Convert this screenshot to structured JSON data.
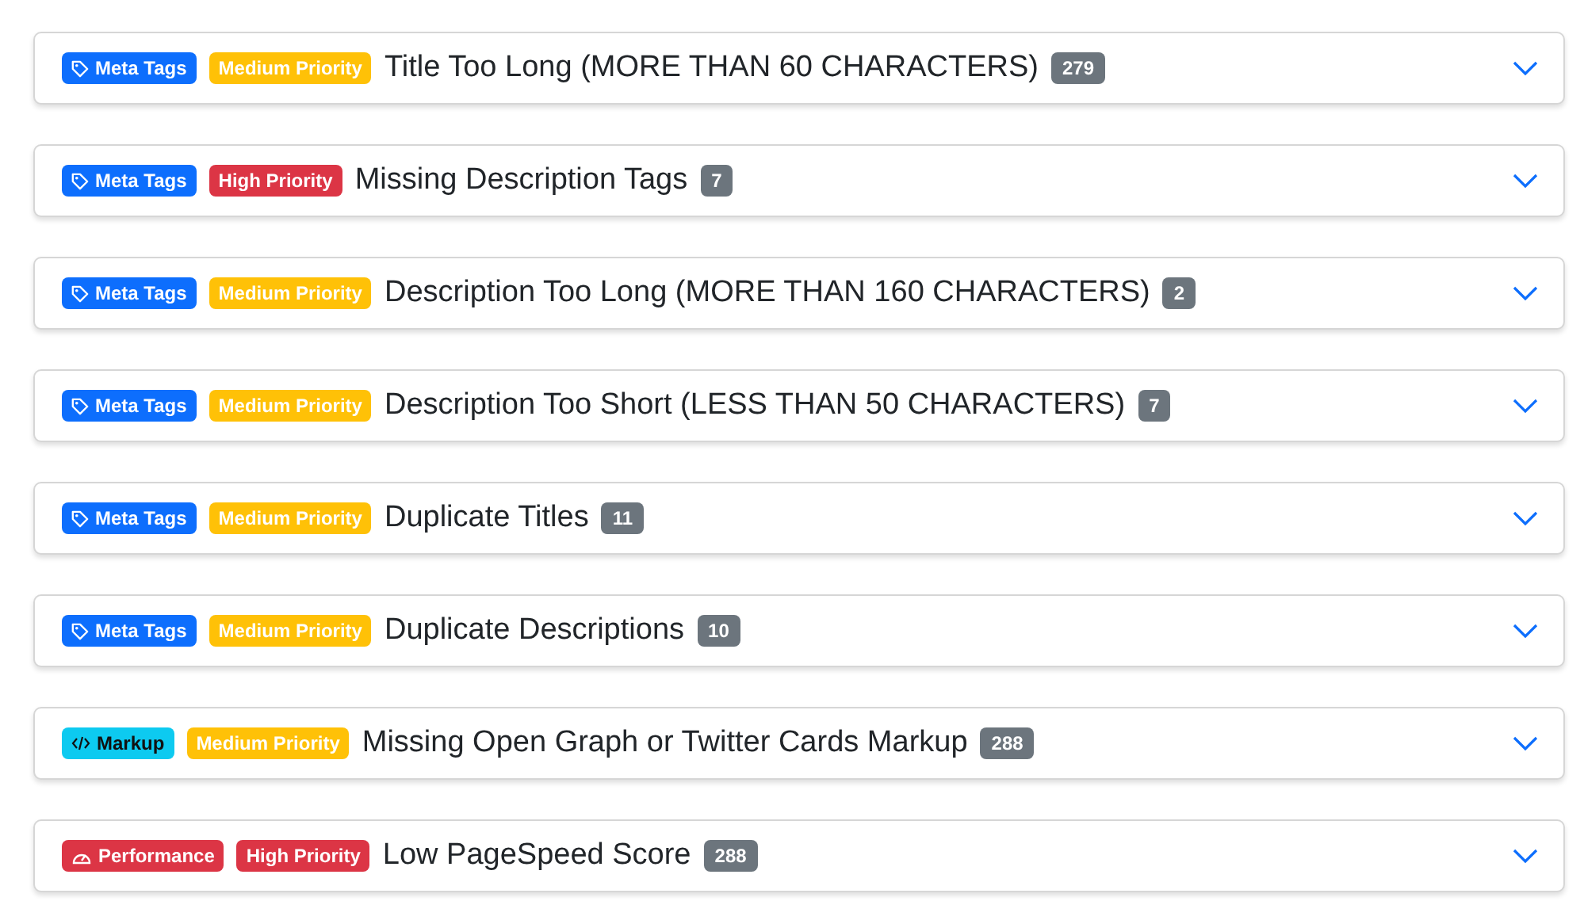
{
  "issues": [
    {
      "category": {
        "kind": "meta",
        "label": "Meta Tags"
      },
      "priority": {
        "kind": "medium",
        "label": "Medium Priority"
      },
      "title": "Title Too Long (MORE THAN 60 CHARACTERS)",
      "count": "279",
      "expanded": false
    },
    {
      "category": {
        "kind": "meta",
        "label": "Meta Tags"
      },
      "priority": {
        "kind": "high",
        "label": "High Priority"
      },
      "title": "Missing Description Tags",
      "count": "7",
      "expanded": false
    },
    {
      "category": {
        "kind": "meta",
        "label": "Meta Tags"
      },
      "priority": {
        "kind": "medium",
        "label": "Medium Priority"
      },
      "title": "Description Too Long (MORE THAN 160 CHARACTERS)",
      "count": "2",
      "expanded": false
    },
    {
      "category": {
        "kind": "meta",
        "label": "Meta Tags"
      },
      "priority": {
        "kind": "medium",
        "label": "Medium Priority"
      },
      "title": "Description Too Short (LESS THAN 50 CHARACTERS)",
      "count": "7",
      "expanded": false
    },
    {
      "category": {
        "kind": "meta",
        "label": "Meta Tags"
      },
      "priority": {
        "kind": "medium",
        "label": "Medium Priority"
      },
      "title": "Duplicate Titles",
      "count": "11",
      "expanded": false
    },
    {
      "category": {
        "kind": "meta",
        "label": "Meta Tags"
      },
      "priority": {
        "kind": "medium",
        "label": "Medium Priority"
      },
      "title": "Duplicate Descriptions",
      "count": "10",
      "expanded": false
    },
    {
      "category": {
        "kind": "markup",
        "label": "Markup"
      },
      "priority": {
        "kind": "medium",
        "label": "Medium Priority"
      },
      "title": "Missing Open Graph or Twitter Cards Markup",
      "count": "288",
      "expanded": false
    },
    {
      "category": {
        "kind": "performance",
        "label": "Performance"
      },
      "priority": {
        "kind": "high",
        "label": "High Priority"
      },
      "title": "Low PageSpeed Score",
      "count": "288",
      "expanded": false
    }
  ]
}
